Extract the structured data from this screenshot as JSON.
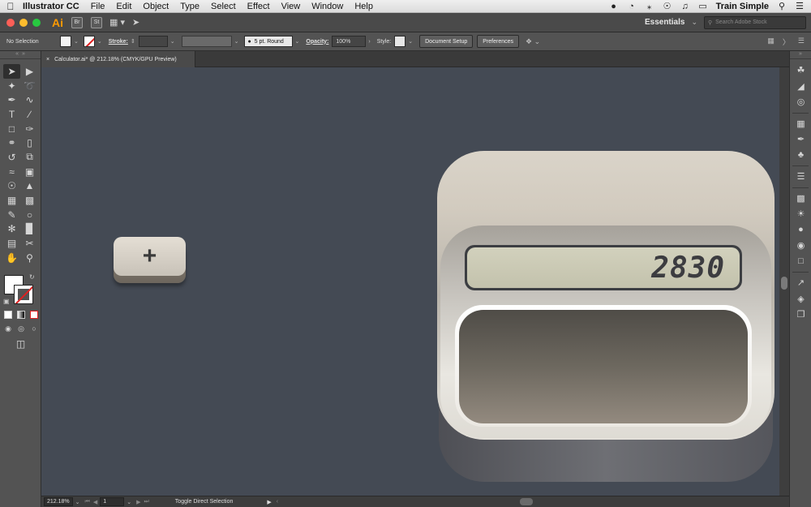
{
  "menubar": {
    "app_name": "Illustrator CC",
    "items": [
      "File",
      "Edit",
      "Object",
      "Type",
      "Select",
      "Effect",
      "View",
      "Window",
      "Help"
    ],
    "user": "Train Simple"
  },
  "appbar": {
    "logo": "Ai",
    "bridge": "Br",
    "stock": "St",
    "workspace": "Essentials",
    "search_placeholder": "Search Adobe Stock"
  },
  "controlbar": {
    "selection": "No Selection",
    "stroke_label": "Stroke:",
    "brush": "5 pt. Round",
    "opacity_label": "Opacity:",
    "opacity_value": "100%",
    "style_label": "Style:",
    "document_setup": "Document Setup",
    "preferences": "Preferences"
  },
  "document": {
    "tab_title": "Calculator.ai* @ 212.18% (CMYK/GPU Preview)",
    "close": "×"
  },
  "canvas": {
    "key_label": "+",
    "display_value": "2830"
  },
  "statusbar": {
    "zoom": "212.18%",
    "artboard": "1",
    "status": "Toggle Direct Selection"
  },
  "colors": {
    "canvas_bg": "#444a54",
    "panel_bg": "#535353",
    "traffic_red": "#fc5f57",
    "traffic_yellow": "#fdbc2e",
    "traffic_green": "#28c840",
    "ai_orange": "#ff9a00"
  },
  "tools": [
    "selection-tool-icon",
    "direct-selection-tool-icon",
    "magic-wand-tool-icon",
    "lasso-tool-icon",
    "pen-tool-icon",
    "curvature-tool-icon",
    "type-tool-icon",
    "line-tool-icon",
    "rectangle-tool-icon",
    "paintbrush-tool-icon",
    "shaper-tool-icon",
    "eraser-tool-icon",
    "rotate-tool-icon",
    "scale-tool-icon",
    "width-tool-icon",
    "free-transform-tool-icon",
    "shape-builder-tool-icon",
    "perspective-grid-tool-icon",
    "mesh-tool-icon",
    "gradient-tool-icon",
    "eyedropper-tool-icon",
    "blend-tool-icon",
    "symbol-sprayer-tool-icon",
    "graph-tool-icon",
    "artboard-tool-icon",
    "slice-tool-icon",
    "hand-tool-icon",
    "zoom-tool-icon"
  ],
  "right_panel_icons": [
    "color-panel-icon",
    "color-guide-icon",
    "appearance-icon",
    "swatches-icon",
    "brushes-icon",
    "symbols-icon",
    "stroke-panel-icon",
    "gradient-panel-icon",
    "transparency-icon",
    "graphic-styles-icon",
    "pathfinder-icon",
    "transform-icon",
    "export-icon",
    "layers-icon",
    "artboards-icon"
  ]
}
